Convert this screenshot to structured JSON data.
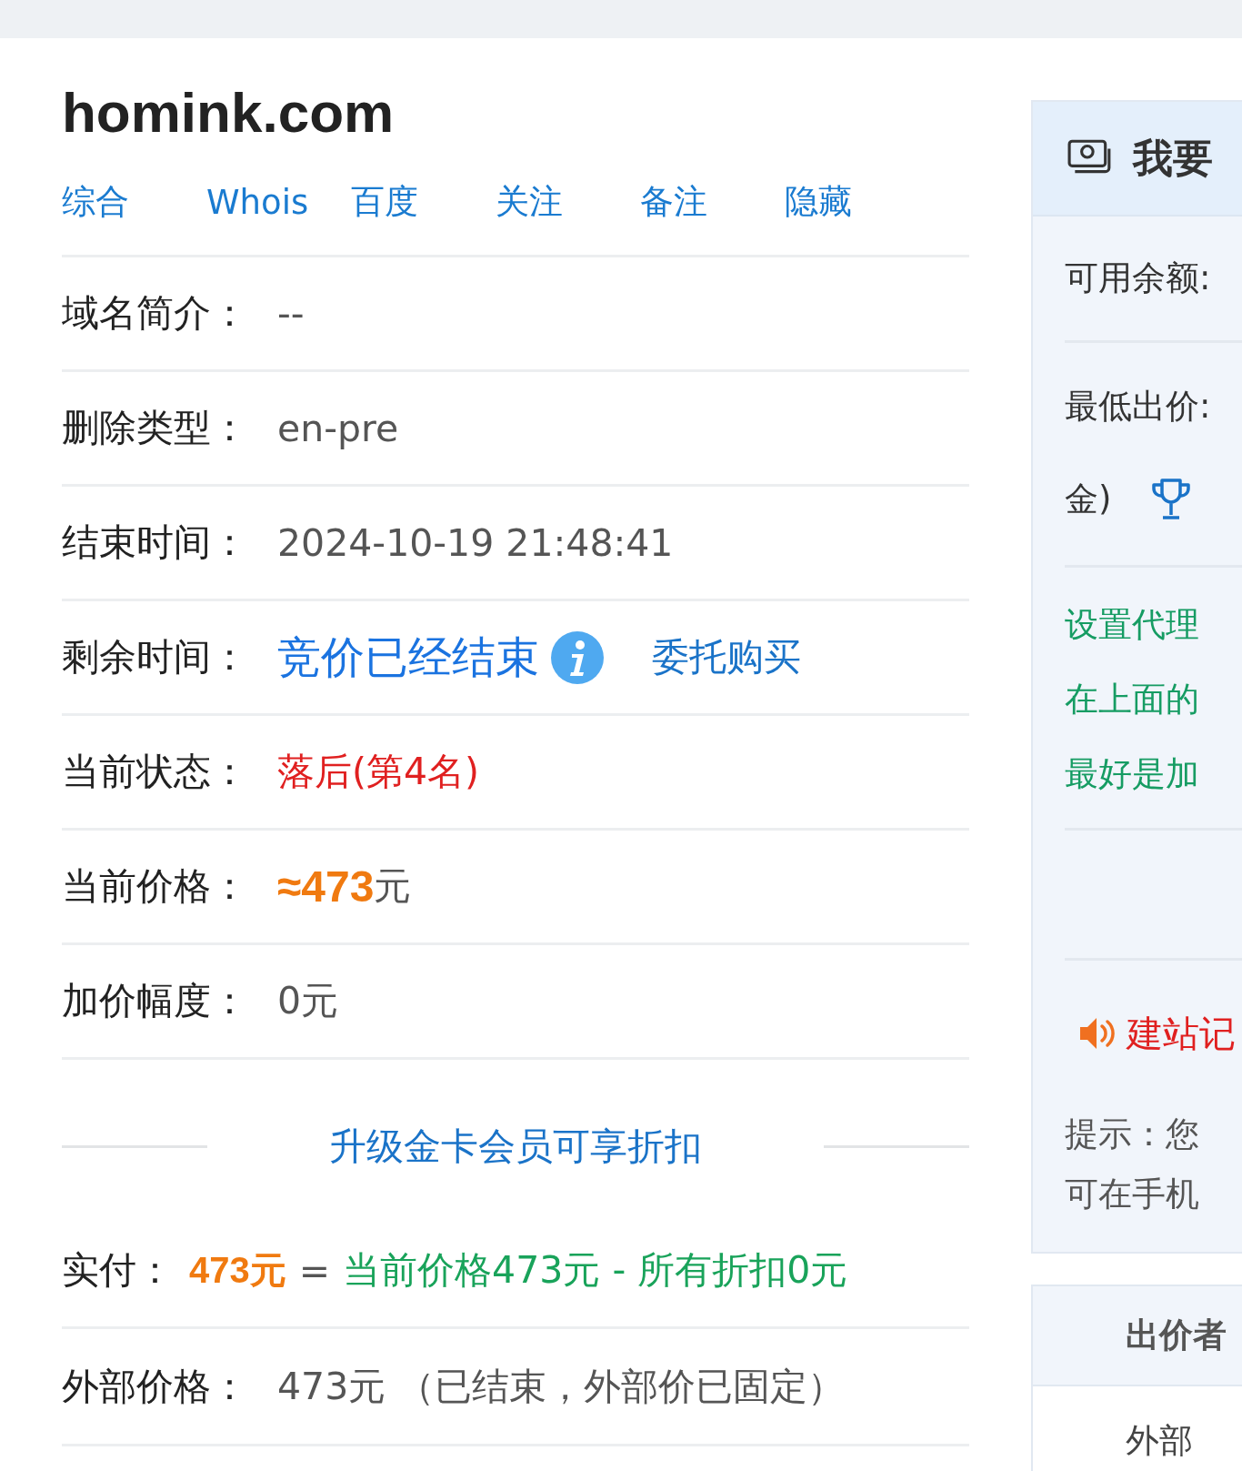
{
  "domain": "homink.com",
  "tabs": [
    {
      "label": "综合"
    },
    {
      "label": "Whois"
    },
    {
      "label": "百度"
    },
    {
      "label": "关注"
    },
    {
      "label": "备注"
    },
    {
      "label": "隐藏"
    }
  ],
  "rows": [
    {
      "kind": "plain",
      "label": "域名简介：",
      "value": "--"
    },
    {
      "kind": "plain",
      "label": "删除类型：",
      "value": "en-pre"
    },
    {
      "kind": "plain",
      "label": "结束时间：",
      "value": "2024-10-19 21:48:41"
    },
    {
      "kind": "ended",
      "label": "剩余时间：",
      "value": "竞价已经结束",
      "link": "委托购买"
    },
    {
      "kind": "status",
      "label": "当前状态：",
      "value": "落后(第4名)"
    },
    {
      "kind": "price",
      "label": "当前价格：",
      "value": "≈473",
      "unit": "元"
    },
    {
      "kind": "plain",
      "label": "加价幅度：",
      "value": "0元"
    }
  ],
  "upgrade_link": "升级金卡会员可享折扣",
  "payment": {
    "label": "实付：",
    "amount": "473元",
    "equals": "=",
    "formula": "当前价格473元 - 所有折扣0元"
  },
  "external": {
    "label": "外部价格：",
    "value": "473元 （已结束，外部价已固定）"
  },
  "bid_panel": {
    "title": "我要",
    "balance_label": "可用余额:",
    "min_bid_label": "最低出价:",
    "min_bid_note": "金)",
    "proxy_lines": [
      "设置代理",
      "在上面的",
      "最好是加"
    ],
    "notice": "建站记",
    "tips": [
      "提示：您",
      "可在手机"
    ]
  },
  "bidders_panel": {
    "header": "出价者",
    "rows": [
      "外部"
    ]
  }
}
